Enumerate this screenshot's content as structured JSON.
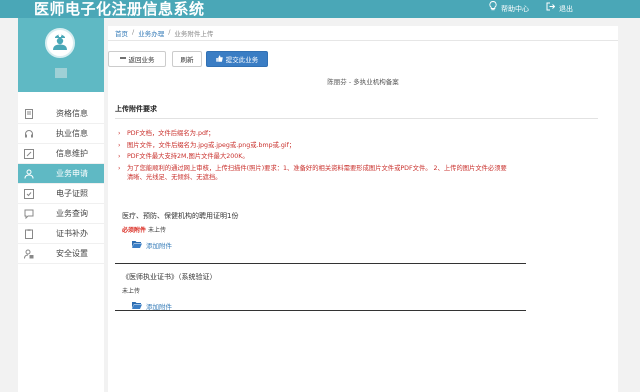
{
  "header": {
    "title": "医师电子化注册信息系统",
    "help_label": "帮助中心",
    "logout_label": "退出"
  },
  "sidebar": {
    "items": [
      {
        "label": "资格信息",
        "icon": "document-icon",
        "active": false
      },
      {
        "label": "执业信息",
        "icon": "headset-icon",
        "active": false
      },
      {
        "label": "信息维护",
        "icon": "edit-icon",
        "active": false
      },
      {
        "label": "业务申请",
        "icon": "user-icon",
        "active": true
      },
      {
        "label": "电子证照",
        "icon": "certificate-icon",
        "active": false
      },
      {
        "label": "业务查询",
        "icon": "chat-icon",
        "active": false
      },
      {
        "label": "证书补办",
        "icon": "clipboard-icon",
        "active": false
      },
      {
        "label": "安全设置",
        "icon": "person-lock-icon",
        "active": false
      }
    ]
  },
  "breadcrumb": {
    "home": "首页",
    "sep": "/",
    "level2": "业务办理",
    "level3": "业务附件上传"
  },
  "toolbar": {
    "back_label": "返回业务",
    "refresh_label": "刷新",
    "submit_label": "提交此业务"
  },
  "page_subtitle": "陈丽芬 - 多执业机构备案",
  "requirements": {
    "title": "上传附件要求",
    "items": [
      "PDF文档，文件后缀名为.pdf；",
      "图片文件，文件后缀名为.jpg或.jpeg或.png或.bmp或.gif；",
      "PDF文件最大支持2M,图片文件最大200K。",
      "为了您能顺利的通过网上审核，上传扫描件(照片)要求：1、准备好的相关资料需要形成图片文件或PDF文件。 2、上传的图片文件必须要清晰、光线足、无倾斜、无遮挡。"
    ]
  },
  "attachments": [
    {
      "title": "医疗、预防、保健机构的聘用证明1份",
      "required_tag": "必须附件",
      "status": "未上传",
      "add_label": "添加附件"
    },
    {
      "title": "《医师执业证书》（系统验证）",
      "required_tag": "",
      "status": "未上传",
      "add_label": "添加附件"
    }
  ]
}
